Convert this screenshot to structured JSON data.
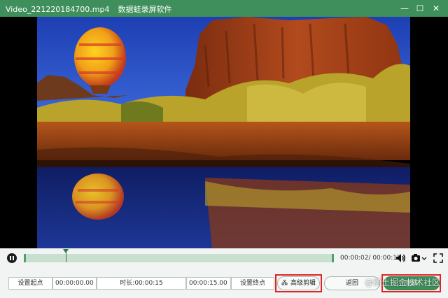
{
  "window": {
    "filename": "Video_221220184700.mp4",
    "app_name": "数据蛙录屏软件",
    "minimize_glyph": "—",
    "maximize_glyph": "☐",
    "close_glyph": "✕"
  },
  "player": {
    "timecode": "00:00:02/ 00:00:15",
    "progress_fraction": 0.13
  },
  "trim": {
    "set_start_label": "设置起点",
    "start_time": "00:00:00.00",
    "duration_label": "时长:",
    "duration_value": "00:00:15",
    "end_time": "00:00:15.00",
    "set_end_label": "设置终点"
  },
  "actions": {
    "advanced_trim_label": "高级剪辑",
    "back_label": "返回",
    "done_label": "完成"
  },
  "watermark": "@稀土掘金技术社区",
  "icons": {
    "pause": "pause-icon",
    "volume": "volume-icon",
    "camera": "camera-icon",
    "fullscreen": "fullscreen-icon",
    "scissors": "scissors-icon"
  },
  "colors": {
    "title_bar": "#3e8f5b",
    "accent": "#48a565",
    "highlight_box": "#e02424"
  }
}
